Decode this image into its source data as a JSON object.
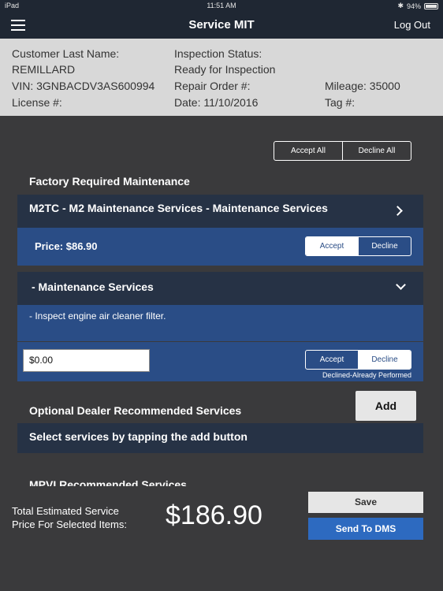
{
  "status_bar": {
    "device": "iPad",
    "time": "11:51 AM",
    "battery": "94%"
  },
  "nav": {
    "title": "Service MIT",
    "logout": "Log Out"
  },
  "info": {
    "customer_label": "Customer Last Name:",
    "customer_value": "REMILLARD",
    "vin": "VIN:  3GNBACDV3AS600994",
    "license": "License #:",
    "status_label": "Inspection Status:",
    "status_value": "Ready for Inspection",
    "repair_order": "Repair Order #:",
    "date": "Date:  11/10/2016",
    "mileage": "Mileage:  35000",
    "tag": "Tag #:"
  },
  "global_actions": {
    "accept_all": "Accept All",
    "decline_all": "Decline All"
  },
  "factory": {
    "heading": "Factory Required Maintenance",
    "package_title": "M2TC - M2 Maintenance Services - Maintenance Services",
    "price_label": "Price: $86.90",
    "accept": "Accept",
    "decline": "Decline",
    "item_title": "- Maintenance Services",
    "item_detail": "- Inspect engine air cleaner filter.",
    "item_price": "$0.00",
    "item_accept": "Accept",
    "item_decline": "Decline",
    "item_note": "Declined-Already Performed"
  },
  "optional": {
    "heading": "Optional Dealer Recommended Services",
    "add": "Add",
    "hint": "Select services by tapping the add button"
  },
  "mpvi": {
    "heading": "MPVI Recommended Services"
  },
  "footer": {
    "total_label_1": "Total Estimated Service",
    "total_label_2": "Price For Selected Items:",
    "total_value": "$186.90",
    "save": "Save",
    "send": "Send To DMS"
  },
  "colors": {
    "header": "#1f2733",
    "row_dark": "#263245",
    "row_blue": "#2a4d86",
    "send_button": "#2d6ac0",
    "info_panel": "#d8d8d8"
  }
}
